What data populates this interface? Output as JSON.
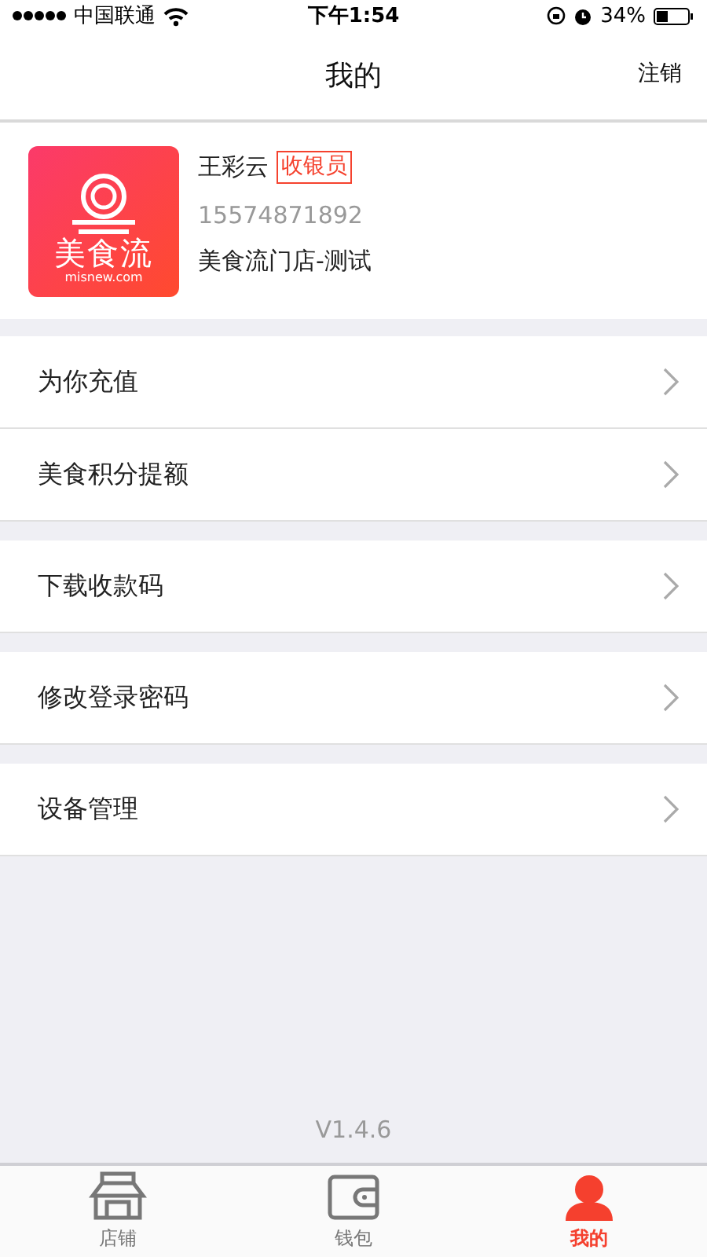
{
  "status_bar": {
    "carrier": "中国联通",
    "time": "下午1:54",
    "battery": "34%"
  },
  "nav": {
    "title": "我的",
    "action": "注销"
  },
  "profile": {
    "logo_name": "美食流",
    "logo_domain": "misnew.com",
    "name": "王彩云",
    "role": "收银员",
    "phone": "15574871892",
    "store": "美食流门店-测试"
  },
  "menu_groups": [
    {
      "items": [
        "为你充值",
        "美食积分提额"
      ]
    },
    {
      "items": [
        "下载收款码"
      ]
    },
    {
      "items": [
        "修改登录密码"
      ]
    },
    {
      "items": [
        "设备管理"
      ]
    }
  ],
  "version": "V1.4.6",
  "tabs": [
    {
      "kind": "store",
      "label": "店铺",
      "selected": false
    },
    {
      "kind": "wallet",
      "label": "钱包",
      "selected": false
    },
    {
      "kind": "person",
      "label": "我的",
      "selected": true
    }
  ]
}
